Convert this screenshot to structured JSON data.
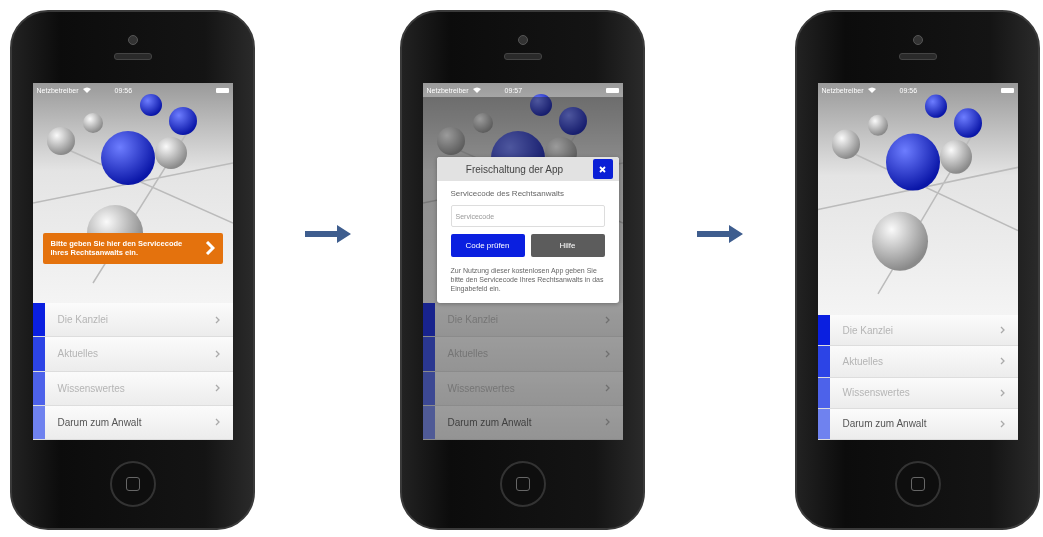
{
  "screens": [
    {
      "kind": "banner",
      "status_bar": {
        "carrier": "Netzbetreiber",
        "time": "09:56"
      },
      "banner": {
        "text": "Bitte geben Sie hier den Servicecode Ihres Rechtsanwalts ein."
      },
      "menu": [
        {
          "label": "Die Kanzlei",
          "color": "#0a1fe0",
          "dimmed": true
        },
        {
          "label": "Aktuelles",
          "color": "#2c44e6",
          "dimmed": true
        },
        {
          "label": "Wissenswertes",
          "color": "#4d62ea",
          "dimmed": true
        },
        {
          "label": "Darum zum Anwalt",
          "color": "#6f82ef",
          "dimmed": false
        }
      ]
    },
    {
      "kind": "dialog",
      "status_bar": {
        "carrier": "Netzbetreiber",
        "time": "09:57"
      },
      "dialog": {
        "title": "Freischaltung der App",
        "field_label": "Servicecode des Rechtsanwalts",
        "placeholder": "Servicecode",
        "buttons": [
          {
            "label": "Code prüfen",
            "kind": "primary"
          },
          {
            "label": "Hilfe",
            "kind": "secondary"
          }
        ],
        "note": "Zur Nutzung dieser kostenlosen App geben Sie bitte den Servicecode Ihres Rechtsanwalts in das Eingabefeld ein."
      },
      "menu": [
        {
          "label": "Die Kanzlei",
          "color": "#18238d",
          "dimmed": true
        },
        {
          "label": "Aktuelles",
          "color": "#2a3790",
          "dimmed": true
        },
        {
          "label": "Wissenswertes",
          "color": "#3c4893",
          "dimmed": true
        },
        {
          "label": "Darum zum Anwalt",
          "color": "#4f5a96",
          "dimmed": false
        }
      ]
    },
    {
      "kind": "plain",
      "status_bar": {
        "carrier": "Netzbetreiber",
        "time": "09:56"
      },
      "menu": [
        {
          "label": "Die Kanzlei",
          "color": "#0a1fe0",
          "dimmed": true
        },
        {
          "label": "Aktuelles",
          "color": "#2c44e6",
          "dimmed": true
        },
        {
          "label": "Wissenswertes",
          "color": "#4d62ea",
          "dimmed": true
        },
        {
          "label": "Darum zum Anwalt",
          "color": "#6f82ef",
          "dimmed": false
        }
      ]
    }
  ]
}
